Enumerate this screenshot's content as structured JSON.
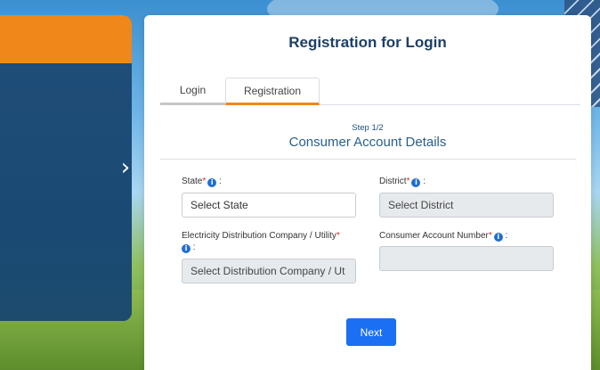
{
  "card": {
    "title": "Registration for Login"
  },
  "tabs": [
    {
      "label": "Login",
      "active": false
    },
    {
      "label": "Registration",
      "active": true
    }
  ],
  "step": {
    "indicator": "Step 1/2",
    "title": "Consumer Account Details"
  },
  "fields": {
    "state": {
      "label": "State",
      "required": "*",
      "suffix": " :",
      "value": "Select State"
    },
    "district": {
      "label": "District",
      "required": "*",
      "suffix": " :",
      "value": "Select District"
    },
    "utility": {
      "label": "Electricity Distribution Company / Utility",
      "required": "*",
      "suffix": " :",
      "value": "Select Distribution Company / Ut"
    },
    "account": {
      "label": "Consumer Account Number",
      "required": "*",
      "suffix": " :",
      "value": ""
    }
  },
  "buttons": {
    "next": "Next"
  },
  "promo": {
    "arrow": "›"
  },
  "colors": {
    "accent": "#f0871a",
    "primary": "#1b6ff3",
    "heading": "#1d3f66",
    "promo_bg": "#1d4a72"
  },
  "icons": {
    "info": "info-icon",
    "next_arrow": "chevron-right-icon"
  }
}
